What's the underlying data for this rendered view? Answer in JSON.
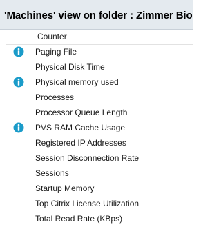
{
  "panel": {
    "title": "'Machines' view on folder : Zimmer Bio"
  },
  "list": {
    "column_header": "Counter",
    "rows": [
      {
        "label": "Paging File",
        "icon": "info-icon"
      },
      {
        "label": "Physical Disk Time",
        "icon": null
      },
      {
        "label": "Physical memory used",
        "icon": "info-icon"
      },
      {
        "label": "Processes",
        "icon": null
      },
      {
        "label": "Processor Queue Length",
        "icon": null
      },
      {
        "label": "PVS RAM Cache Usage",
        "icon": "info-icon"
      },
      {
        "label": "Registered IP Addresses",
        "icon": null
      },
      {
        "label": "Session Disconnection Rate",
        "icon": null
      },
      {
        "label": "Sessions",
        "icon": null
      },
      {
        "label": "Startup Memory",
        "icon": null
      },
      {
        "label": "Top Citrix License Utilization",
        "icon": null
      },
      {
        "label": "Total Read Rate (KBps)",
        "icon": null
      }
    ]
  },
  "colors": {
    "title_background": "#e4eaef",
    "info_icon": "#1a9bc9"
  }
}
